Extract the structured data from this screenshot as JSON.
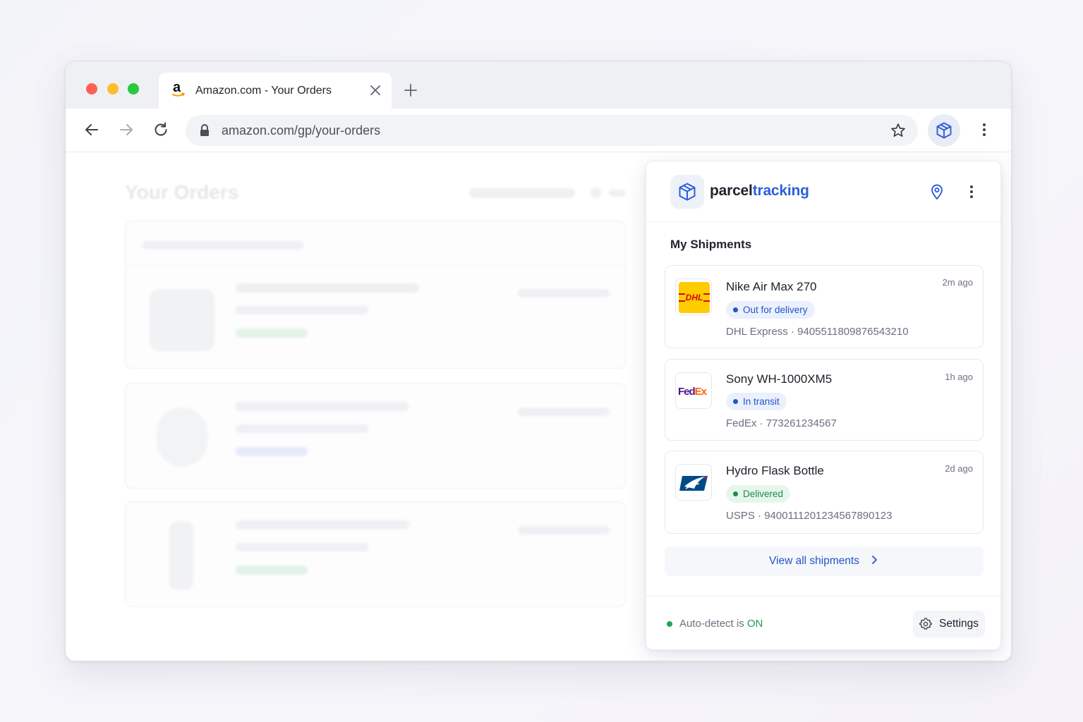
{
  "browser": {
    "tab": {
      "title": "Amazon.com - Your Orders",
      "favicon": "amazon-logo"
    },
    "address": {
      "url": "amazon.com/gp/your-orders"
    },
    "page": {
      "heading": "Your Orders"
    }
  },
  "extension": {
    "brand": {
      "part1": "parcel",
      "part2": "tracking"
    },
    "section_title": "My Shipments",
    "shipments": [
      {
        "name": "Nike Air Max 270",
        "time": "2m ago",
        "status": "Out for delivery",
        "carrier": "DHL Express",
        "separator": " · ",
        "tracking": "9405511809876543210",
        "carrier_logo": "dhl-logo",
        "status_color": "#2454c9"
      },
      {
        "name": "Sony WH-1000XM5",
        "time": "1h ago",
        "status": "In transit",
        "carrier": "FedEx",
        "separator": " · ",
        "tracking": "773261234567",
        "carrier_logo": "fedex-logo",
        "status_color": "#2454c9"
      },
      {
        "name": "Hydro Flask Bottle",
        "time": "2d ago",
        "status": "Delivered",
        "carrier": "USPS",
        "separator": " · ",
        "tracking": "9400111201234567890123",
        "carrier_logo": "usps-logo",
        "status_color": "#1e8a4c"
      }
    ],
    "view_all_label": "View all shipments",
    "footer": {
      "auto_prefix": "Auto-detect is ",
      "auto_state": "ON",
      "settings_label": "Settings"
    }
  },
  "colors": {
    "accent": "#2b5fd9",
    "dhl_yellow": "#ffcc00",
    "dhl_red": "#d40511",
    "fedex_purple": "#4d148c",
    "fedex_orange": "#ff6600",
    "usps_blue": "#004b87"
  }
}
